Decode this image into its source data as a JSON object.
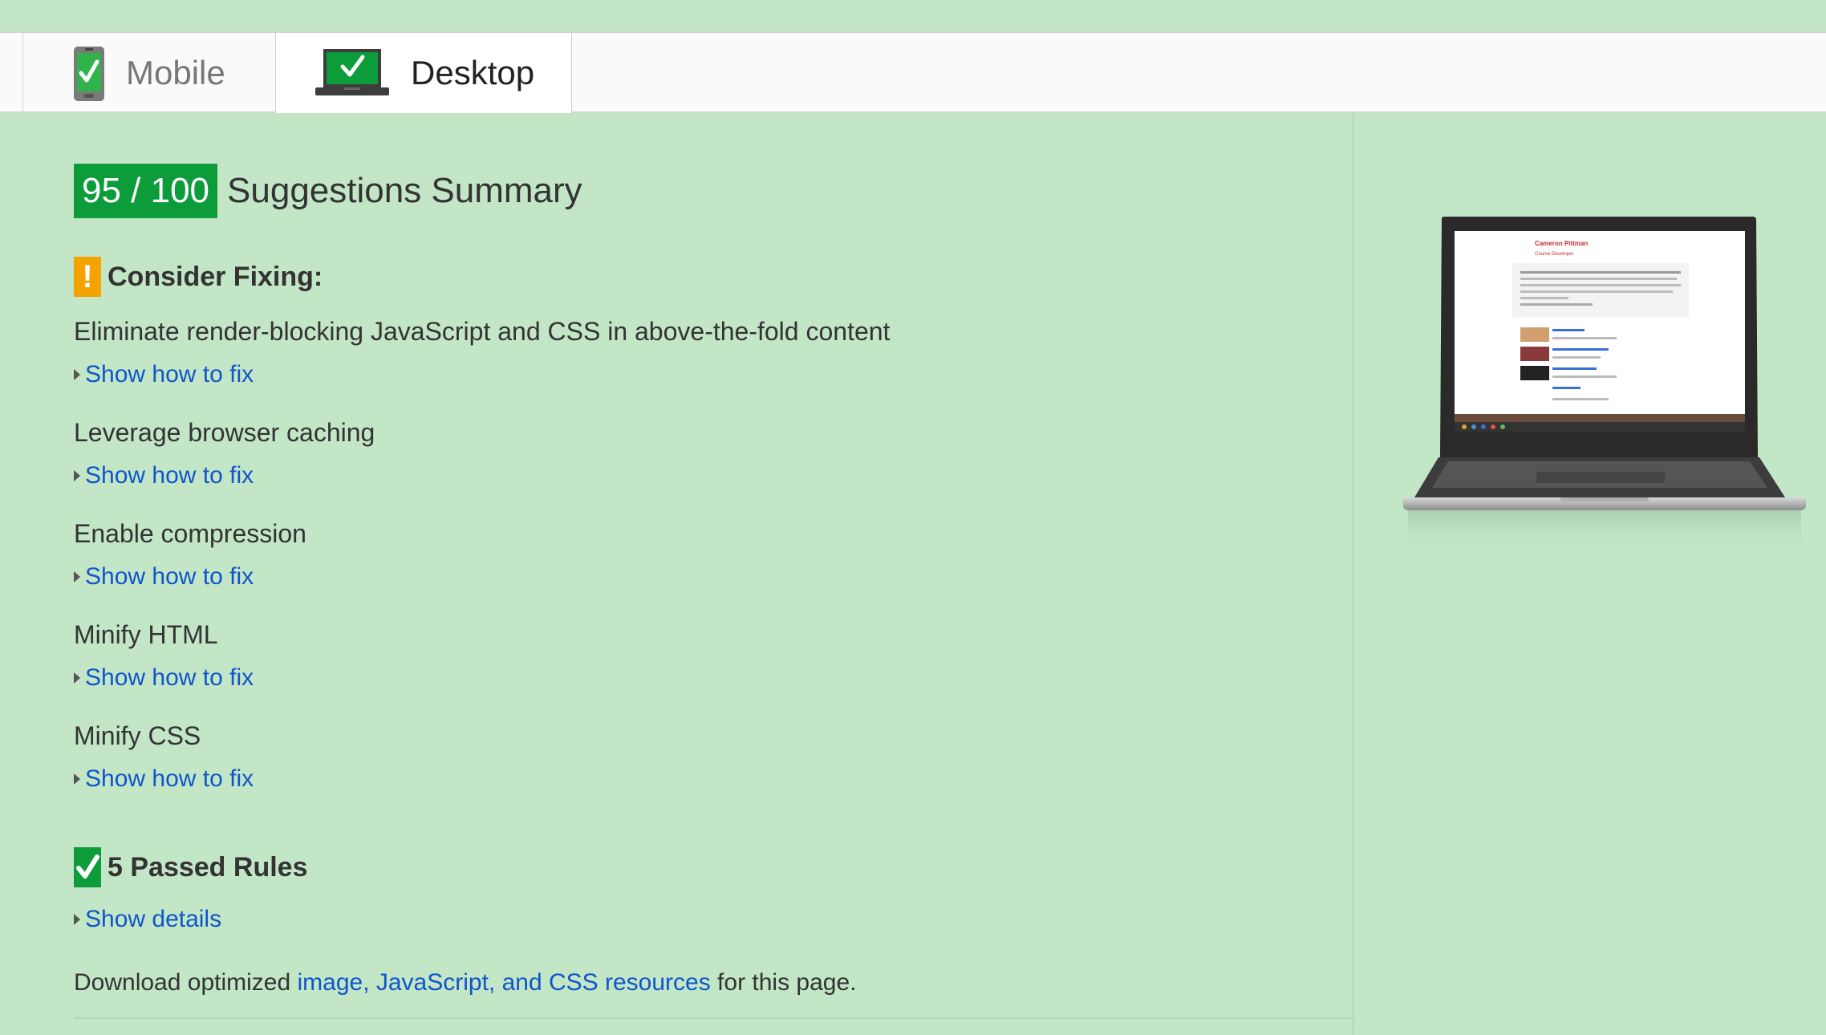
{
  "tabs": [
    {
      "label": "Mobile",
      "icon": "phone-check-icon",
      "active": false
    },
    {
      "label": "Desktop",
      "icon": "laptop-check-icon",
      "active": true
    }
  ],
  "summary": {
    "score": "95 / 100",
    "title": "Suggestions Summary",
    "score_color": "#0c9c3a"
  },
  "consider": {
    "title": "Consider Fixing:",
    "icon": "warning-icon",
    "color": "#f4a300",
    "rules": [
      {
        "name": "Eliminate render-blocking JavaScript and CSS in above-the-fold content",
        "link": "Show how to fix"
      },
      {
        "name": "Leverage browser caching",
        "link": "Show how to fix"
      },
      {
        "name": "Enable compression",
        "link": "Show how to fix"
      },
      {
        "name": "Minify HTML",
        "link": "Show how to fix"
      },
      {
        "name": "Minify CSS",
        "link": "Show how to fix"
      }
    ]
  },
  "passed": {
    "title": "5 Passed Rules",
    "icon": "checkmark-icon",
    "link": "Show details"
  },
  "download": {
    "prefix": "Download optimized ",
    "link": "image, JavaScript, and CSS resources",
    "suffix": " for this page."
  },
  "preview": {
    "name": "Cameron Pittman",
    "role": "Course Developer"
  },
  "colors": {
    "background": "#c2e6c6",
    "link": "#1155cc"
  }
}
